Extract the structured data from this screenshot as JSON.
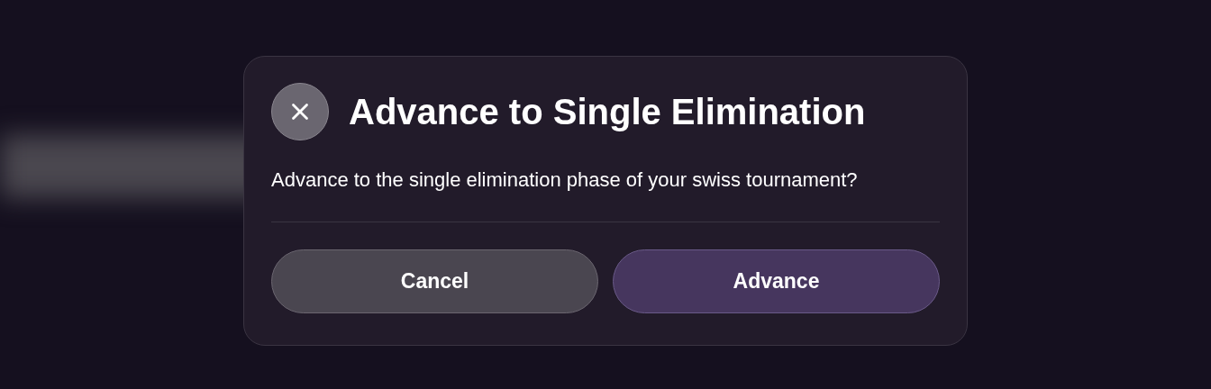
{
  "dialog": {
    "title": "Advance to Single Elimination",
    "message": "Advance to the single elimination phase of your swiss tournament?",
    "buttons": [
      {
        "label": "Cancel",
        "kind": "secondary"
      },
      {
        "label": "Advance",
        "kind": "primary"
      }
    ]
  }
}
